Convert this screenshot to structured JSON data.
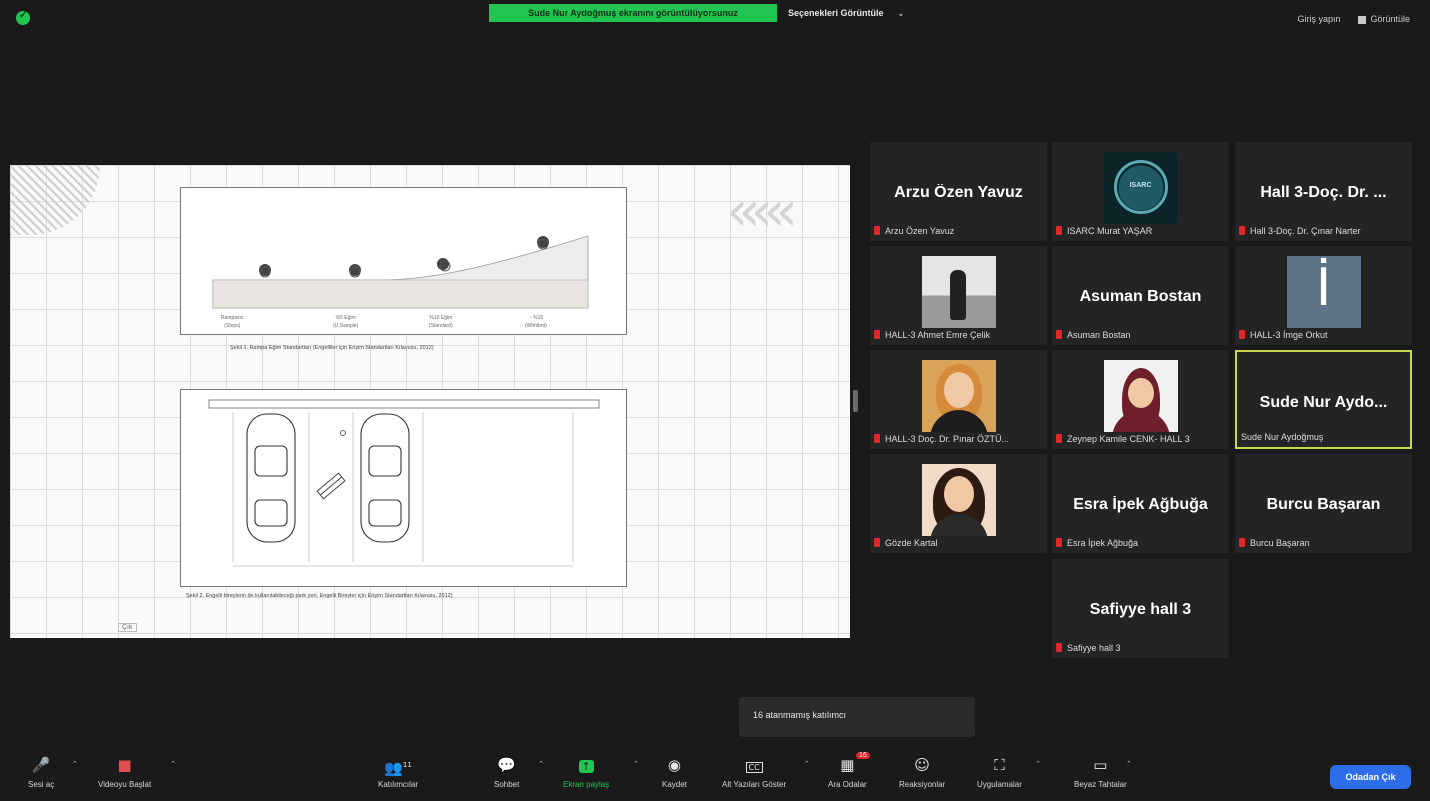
{
  "topbar": {
    "share_banner": "Sude Nur Aydoğmuş ekranını görüntülüyorsunuz",
    "view_options": "Seçenekleri Görüntüle",
    "signin": "Giriş yapın",
    "view": "Görüntüle"
  },
  "shared_screen": {
    "fig1_labels": [
      {
        "top": "Rampasız",
        "bottom": "(Steps)"
      },
      {
        "top": "%5 Eğim",
        "bottom": "(U.Sample)"
      },
      {
        "top": "%10 Eğim",
        "bottom": "(Standard)"
      },
      {
        "top": "~ %15",
        "bottom": "(Whhlbrd)"
      }
    ],
    "fig1_caption": "Şekil 1. Rampa Eğim Standartları (Engelliler için Erişim Standartları Kılavuzu, 2012)",
    "fig2_caption": "Şekil 2. Engelli bireylerin de kullanılabileceği park yeri. Engelli Bireyler için Erişim Standartları Kılavuzu, 2012)",
    "toolbar_tag": "Çık"
  },
  "participants": [
    {
      "big": "Arzu Özen Yavuz",
      "name": "Arzu Özen Yavuz",
      "photo": ""
    },
    {
      "big": "",
      "name": "ISARC Murat YAŞAR",
      "photo": "logo"
    },
    {
      "big": "Hall 3-Doç. Dr. ...",
      "name": "Hall 3-Doç. Dr. Çınar Narter",
      "photo": ""
    },
    {
      "big": "",
      "name": "HALL-3 Ahmet Emre Çelik",
      "photo": "bw"
    },
    {
      "big": "Asuman Bostan",
      "name": "Asuman Bostan",
      "photo": ""
    },
    {
      "big": "",
      "name": "HALL-3 İmge Orkut",
      "photo": "letter",
      "letter": "İ"
    },
    {
      "big": "",
      "name": "HALL-3 Doç. Dr. Pınar ÖZTÜ...",
      "photo": "face1"
    },
    {
      "big": "",
      "name": "Zeynep Kamile CENK- HALL 3",
      "photo": "face2"
    },
    {
      "big": "Sude Nur Aydo...",
      "name": "Sude Nur Aydoğmuş",
      "photo": "",
      "active": true
    },
    {
      "big": "",
      "name": "Gözde Kartal",
      "photo": "face3"
    },
    {
      "big": "Esra İpek Ağbuğa",
      "name": "Esra İpek Ağbuğa",
      "photo": ""
    },
    {
      "big": "Burcu Başaran",
      "name": "Burcu Başaran",
      "photo": ""
    },
    {
      "big": "Safiyye hall 3",
      "name": "Safiyye hall 3",
      "photo": ""
    }
  ],
  "tooltip": "16 atanmamış katılımcı",
  "toolbar": {
    "unmute": "Sesi aç",
    "start_video": "Videoyu Başlat",
    "participants": "Katılımcılar",
    "participants_count": "11",
    "chat": "Sohbet",
    "share": "Ekran paylaş",
    "record": "Kaydet",
    "captions": "Alt Yazıları Göster",
    "breakout": "Ara Odalar",
    "breakout_badge": "16",
    "reactions": "Reaksiyonlar",
    "apps": "Uygulamalar",
    "whiteboard": "Beyaz Tahtalar",
    "leave": "Odadan Çık",
    "captions_icon": "CC"
  },
  "colors": {
    "share_green": "#23c552",
    "leave_blue": "#2d6ee8",
    "active_speaker": "#c9d94a",
    "muted_red": "#e02828"
  }
}
